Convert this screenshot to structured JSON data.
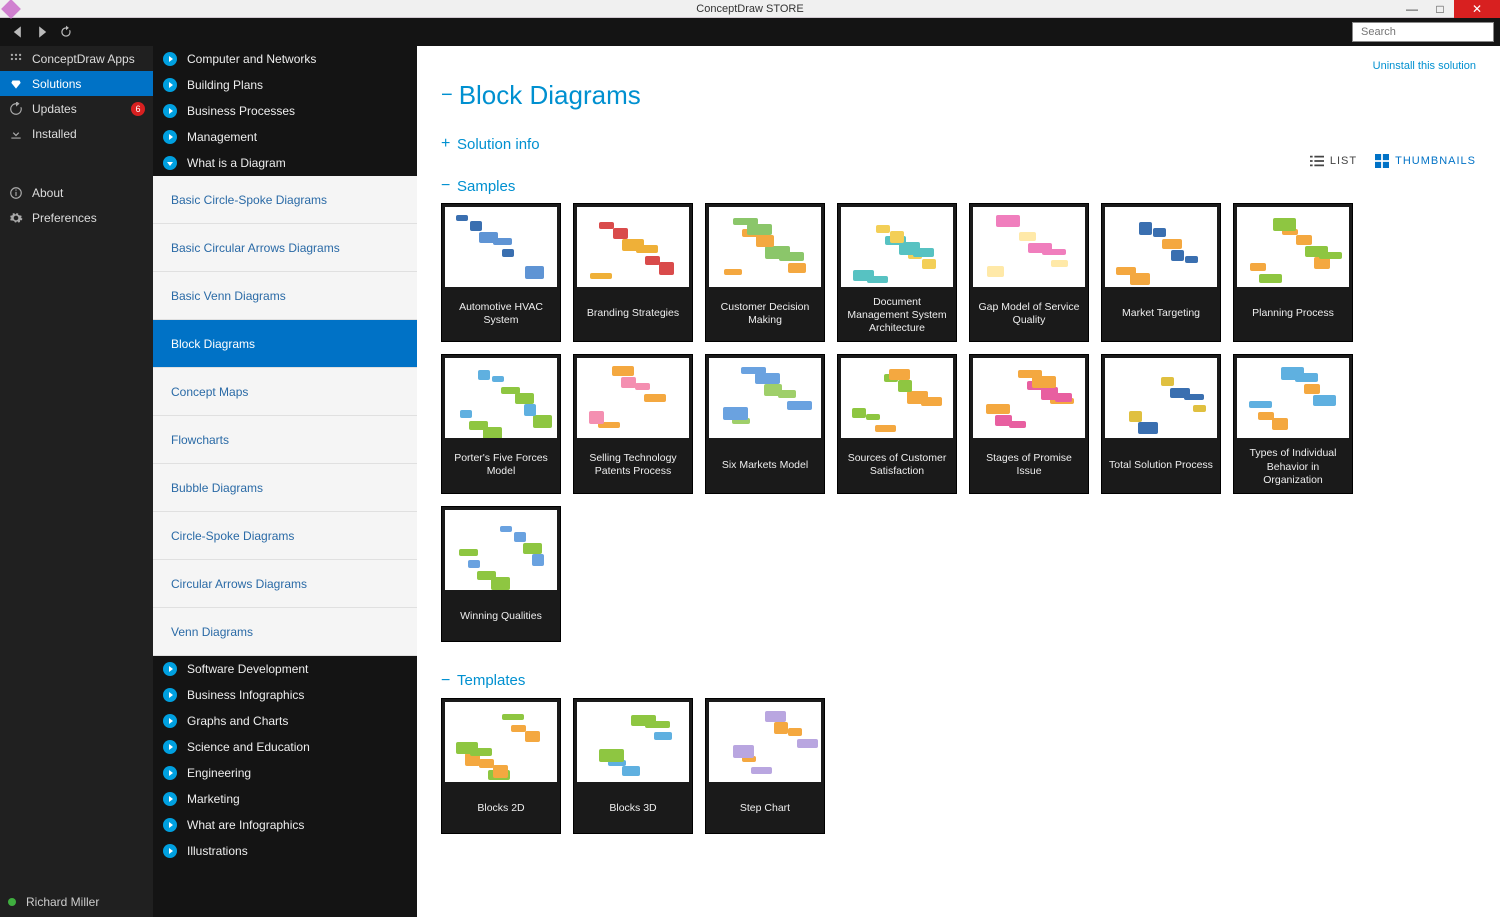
{
  "window": {
    "title": "ConceptDraw STORE"
  },
  "search": {
    "placeholder": "Search"
  },
  "uninstall_label": "Uninstall this solution",
  "sidebar1": {
    "items": [
      {
        "id": "apps",
        "label": "ConceptDraw Apps"
      },
      {
        "id": "solutions",
        "label": "Solutions",
        "active": true
      },
      {
        "id": "updates",
        "label": "Updates",
        "badge": "6"
      },
      {
        "id": "installed",
        "label": "Installed"
      }
    ],
    "lower": [
      {
        "id": "about",
        "label": "About"
      },
      {
        "id": "preferences",
        "label": "Preferences"
      }
    ],
    "user": "Richard Miller"
  },
  "categories": [
    {
      "label": "Computer and Networks"
    },
    {
      "label": "Building Plans"
    },
    {
      "label": "Business Processes"
    },
    {
      "label": "Management"
    },
    {
      "label": "What is a Diagram",
      "expanded": true,
      "sub": [
        {
          "label": "Basic Circle-Spoke Diagrams"
        },
        {
          "label": "Basic Circular Arrows Diagrams"
        },
        {
          "label": "Basic Venn Diagrams"
        },
        {
          "label": "Block Diagrams",
          "selected": true
        },
        {
          "label": "Concept Maps"
        },
        {
          "label": "Flowcharts"
        },
        {
          "label": "Bubble Diagrams"
        },
        {
          "label": "Circle-Spoke Diagrams"
        },
        {
          "label": "Circular Arrows Diagrams"
        },
        {
          "label": "Venn Diagrams"
        }
      ]
    },
    {
      "label": "Software Development"
    },
    {
      "label": "Business Infographics"
    },
    {
      "label": "Graphs and Charts"
    },
    {
      "label": "Science and Education"
    },
    {
      "label": "Engineering"
    },
    {
      "label": "Marketing"
    },
    {
      "label": "What are Infographics"
    },
    {
      "label": "Illustrations"
    }
  ],
  "page": {
    "title": "Block Diagrams"
  },
  "view": {
    "list": "LIST",
    "thumbs": "THUMBNAILS"
  },
  "sections": {
    "info": "Solution info",
    "samples": "Samples",
    "templates": "Templates"
  },
  "samples": [
    {
      "label": "Automotive HVAC System"
    },
    {
      "label": "Branding Strategies"
    },
    {
      "label": "Customer Decision Making"
    },
    {
      "label": "Document Management System Architecture"
    },
    {
      "label": "Gap Model of Service Quality"
    },
    {
      "label": "Market Targeting"
    },
    {
      "label": "Planning Process"
    },
    {
      "label": "Porter's Five Forces Model"
    },
    {
      "label": "Selling Technology Patents Process"
    },
    {
      "label": "Six Markets Model"
    },
    {
      "label": "Sources of Customer Satisfaction"
    },
    {
      "label": "Stages of Promise Issue"
    },
    {
      "label": "Total Solution Process"
    },
    {
      "label": "Types of Individual Behavior in Organization"
    },
    {
      "label": "Winning Qualities"
    }
  ],
  "templates": [
    {
      "label": "Blocks 2D"
    },
    {
      "label": "Blocks 3D"
    },
    {
      "label": "Step Chart"
    }
  ]
}
